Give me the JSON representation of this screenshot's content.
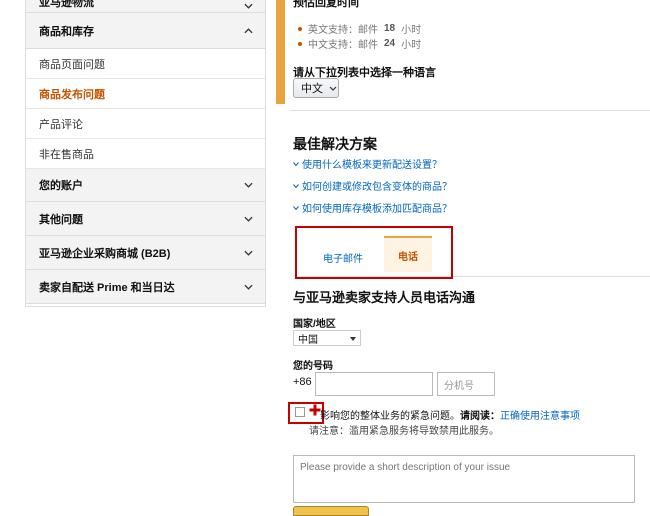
{
  "sidebar": {
    "categories": [
      {
        "label": "亚马逊物流",
        "icon": "chevron-down-icon"
      },
      {
        "label": "商品和库存",
        "icon": "chevron-up-icon"
      }
    ],
    "sub_items": [
      {
        "label": "商品页面问题"
      },
      {
        "label": "商品发布问题"
      },
      {
        "label": "产品评论"
      },
      {
        "label": "非在售商品"
      }
    ],
    "more_categories": [
      {
        "label": "您的账户"
      },
      {
        "label": "其他问题"
      },
      {
        "label": "亚马逊企业采购商城 (B2B)"
      },
      {
        "label": "卖家自配送 Prime 和当日达"
      }
    ]
  },
  "response_time": {
    "title": "预估回复时间",
    "english_prefix": "英文支持：邮件",
    "english_hours": "18",
    "english_unit": "小时",
    "chinese_prefix": "中文支持：邮件",
    "chinese_hours": "24",
    "chinese_unit": "小时"
  },
  "language": {
    "label": "请从下拉列表中选择一种语言",
    "selected": "中文"
  },
  "best_solutions": {
    "title": "最佳解决方案",
    "links": [
      "使用什么模板来更新配送设置？",
      "如何创建或修改包含变体的商品？",
      "如何使用库存模板添加匹配商品？"
    ]
  },
  "tabs": {
    "email": "电子邮件",
    "phone": "电话"
  },
  "phone_form": {
    "title": "与亚马逊卖家支持人员电话沟通",
    "country_label": "国家/地区",
    "country_value": "中国",
    "number_label": "您的号码",
    "prefix": "+86",
    "extension_placeholder": "分机号",
    "urgent_text": "影响您的整体业务的紧急问题。",
    "read_label": "请阅读：",
    "read_link": "正确使用注意事项",
    "note": "请注意：滥用紧急服务将导致禁用此服务。",
    "description_placeholder": "Please provide a short description of your issue"
  },
  "colors": {
    "accent_orange": "#e7a342",
    "active_link": "#c45500",
    "link_blue": "#0066c0",
    "highlight_red": "#c40000"
  }
}
